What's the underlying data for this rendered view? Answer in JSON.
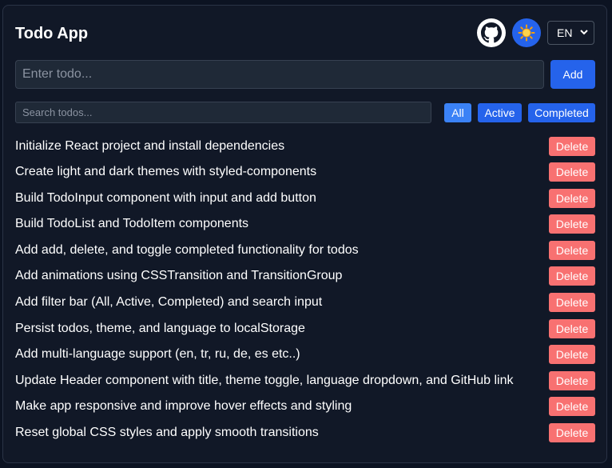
{
  "header": {
    "title": "Todo App",
    "github_icon": "github-icon",
    "theme_icon": "sun-icon",
    "language": "EN"
  },
  "input": {
    "placeholder": "Enter todo...",
    "value": "",
    "add_label": "Add"
  },
  "search": {
    "placeholder": "Search todos...",
    "value": ""
  },
  "filters": {
    "all": "All",
    "active": "Active",
    "completed": "Completed",
    "selected": "All"
  },
  "todos": [
    {
      "text": "Initialize React project and install dependencies",
      "delete_label": "Delete"
    },
    {
      "text": "Create light and dark themes with styled-components",
      "delete_label": "Delete"
    },
    {
      "text": "Build TodoInput component with input and add button",
      "delete_label": "Delete"
    },
    {
      "text": "Build TodoList and TodoItem components",
      "delete_label": "Delete"
    },
    {
      "text": "Add add, delete, and toggle completed functionality for todos",
      "delete_label": "Delete"
    },
    {
      "text": "Add animations using CSSTransition and TransitionGroup",
      "delete_label": "Delete"
    },
    {
      "text": "Add filter bar (All, Active, Completed) and search input",
      "delete_label": "Delete"
    },
    {
      "text": "Persist todos, theme, and language to localStorage",
      "delete_label": "Delete"
    },
    {
      "text": "Add multi-language support (en, tr, ru, de, es etc..)",
      "delete_label": "Delete"
    },
    {
      "text": "Update Header component with title, theme toggle, language dropdown, and GitHub link",
      "delete_label": "Delete"
    },
    {
      "text": "Make app responsive and improve hover effects and styling",
      "delete_label": "Delete"
    },
    {
      "text": "Reset global CSS styles and apply smooth transitions",
      "delete_label": "Delete"
    }
  ],
  "colors": {
    "background": "#111827",
    "primary": "#2563eb",
    "filter_selected": "#3b82f6",
    "danger": "#f87171"
  }
}
